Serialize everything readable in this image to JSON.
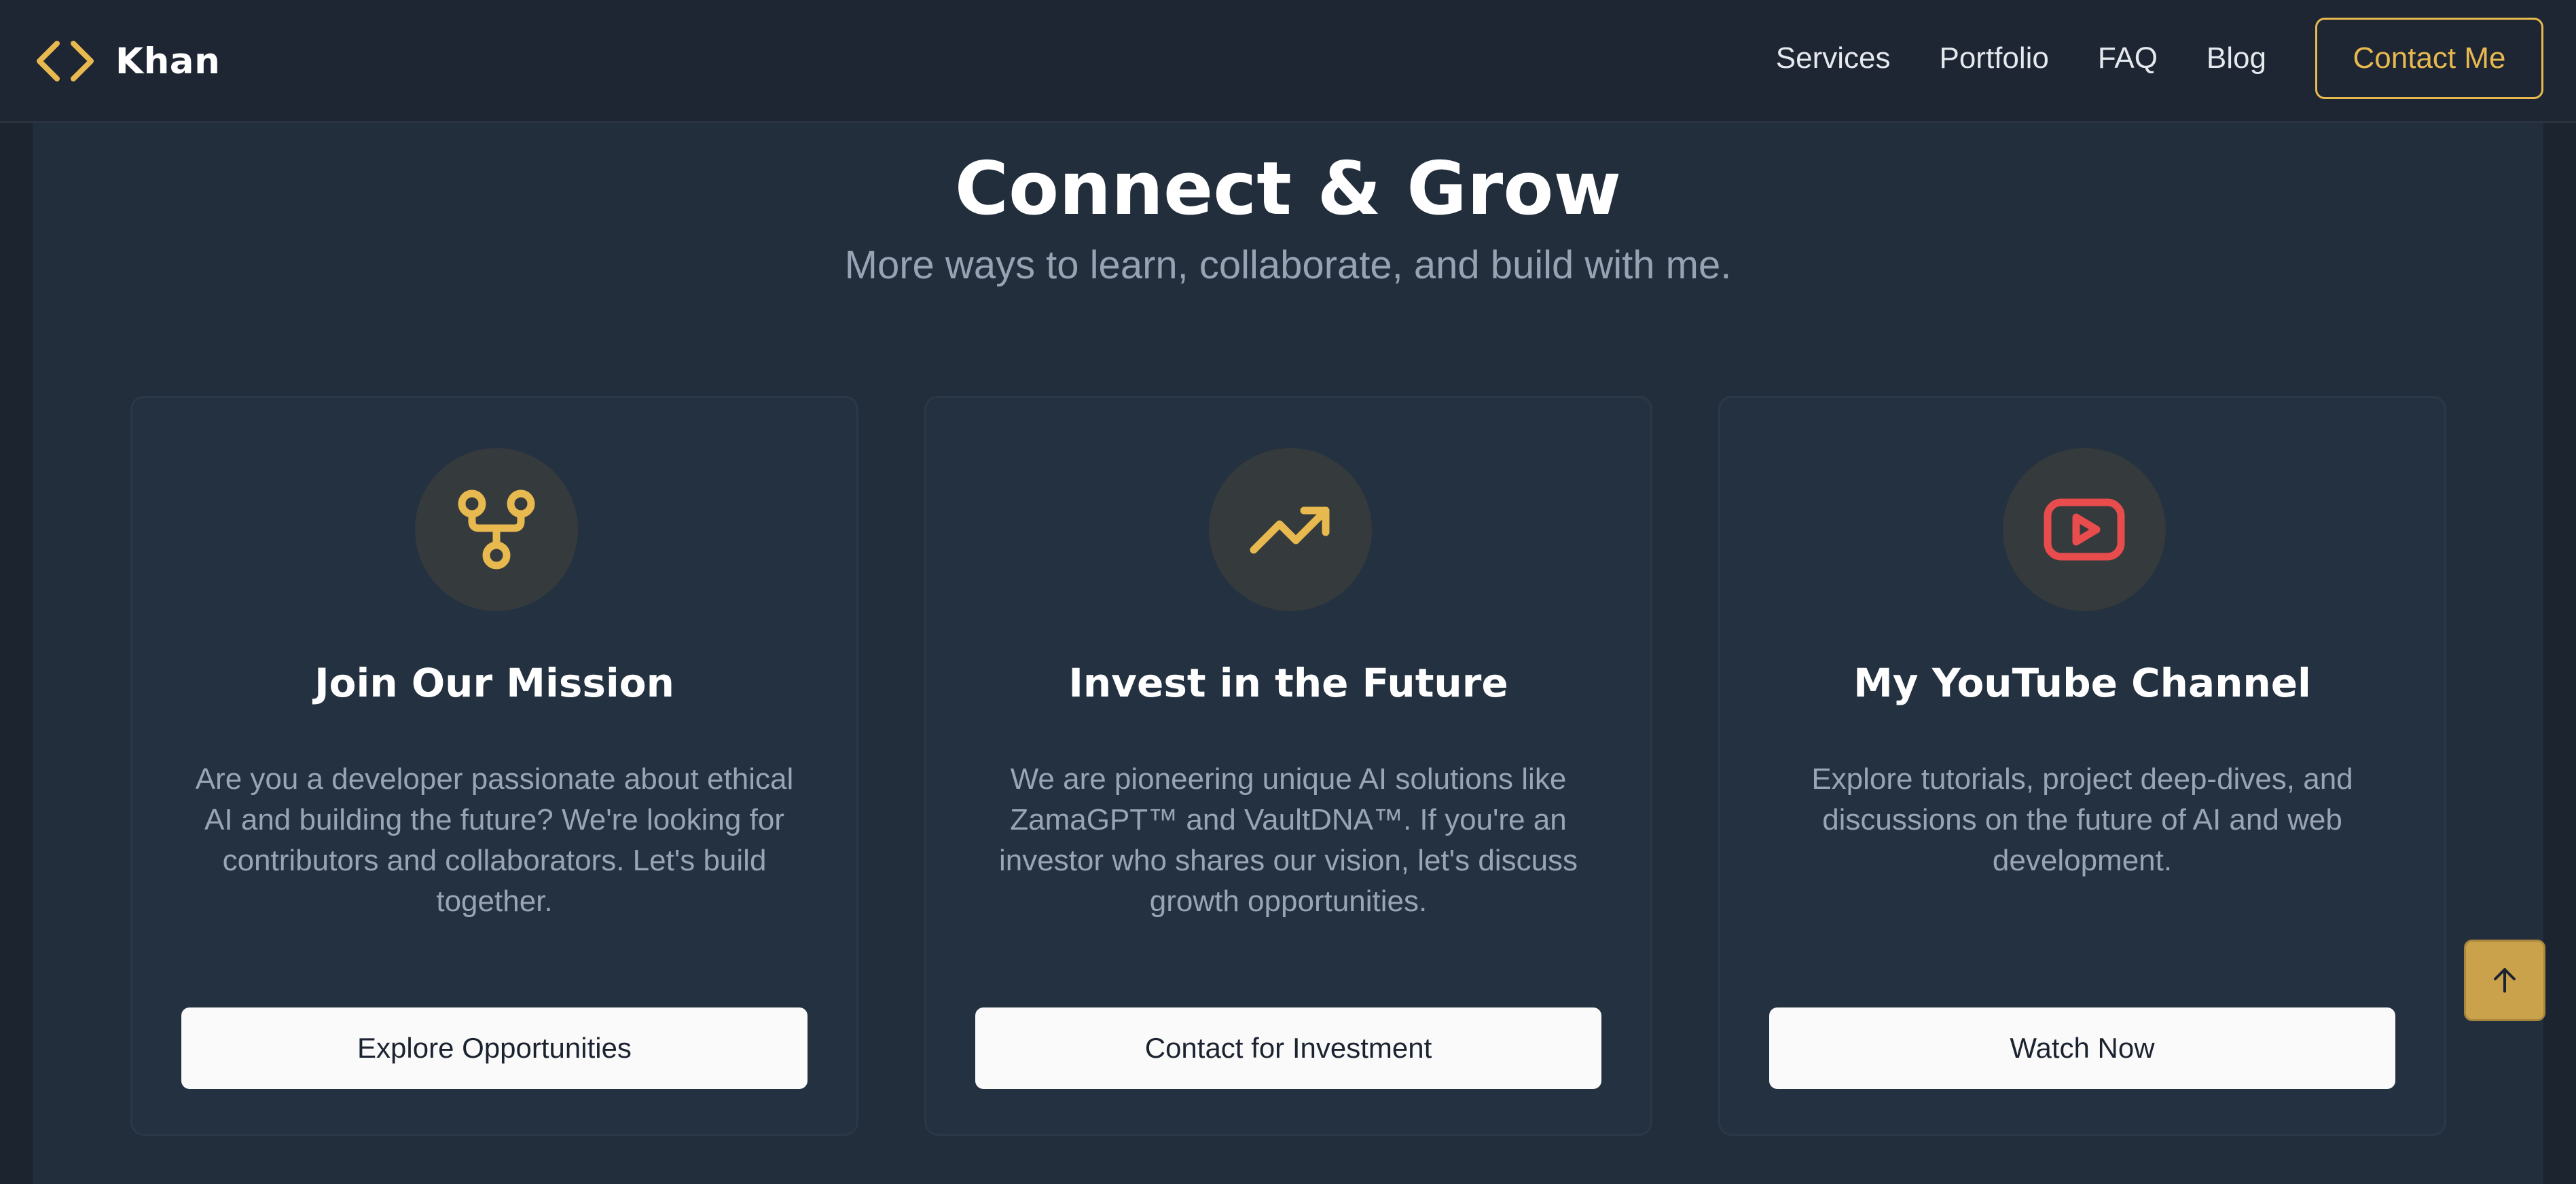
{
  "colors": {
    "accent": "#e8b94f",
    "youtube_red": "#e84c4c",
    "background": "#1c2430",
    "section_bg": "#232e3c",
    "card_bg": "#243140",
    "text_muted": "#9aa5b4"
  },
  "header": {
    "brand": "Khan",
    "logo_icon": "code-brackets-icon",
    "nav": [
      "Services",
      "Portfolio",
      "FAQ",
      "Blog"
    ],
    "contact_label": "Contact Me"
  },
  "section": {
    "title": "Connect & Grow",
    "subtitle": "More ways to learn, collaborate, and build with me."
  },
  "cards": [
    {
      "icon": "git-fork-icon",
      "title": "Join Our Mission",
      "description": "Are you a developer passionate about ethical AI and building the future? We're looking for contributors and collaborators. Let's build together.",
      "button": "Explore Opportunities"
    },
    {
      "icon": "trending-up-icon",
      "title": "Invest in the Future",
      "description": "We are pioneering unique AI solutions like ZamaGPT™ and VaultDNA™. If you're an investor who shares our vision, let's discuss growth opportunities.",
      "button": "Contact for Investment"
    },
    {
      "icon": "youtube-icon",
      "title": "My YouTube Channel",
      "description": "Explore tutorials, project deep-dives, and discussions on the future of AI and web development.",
      "button": "Watch Now"
    }
  ],
  "scroll_top_icon": "arrow-up-icon"
}
